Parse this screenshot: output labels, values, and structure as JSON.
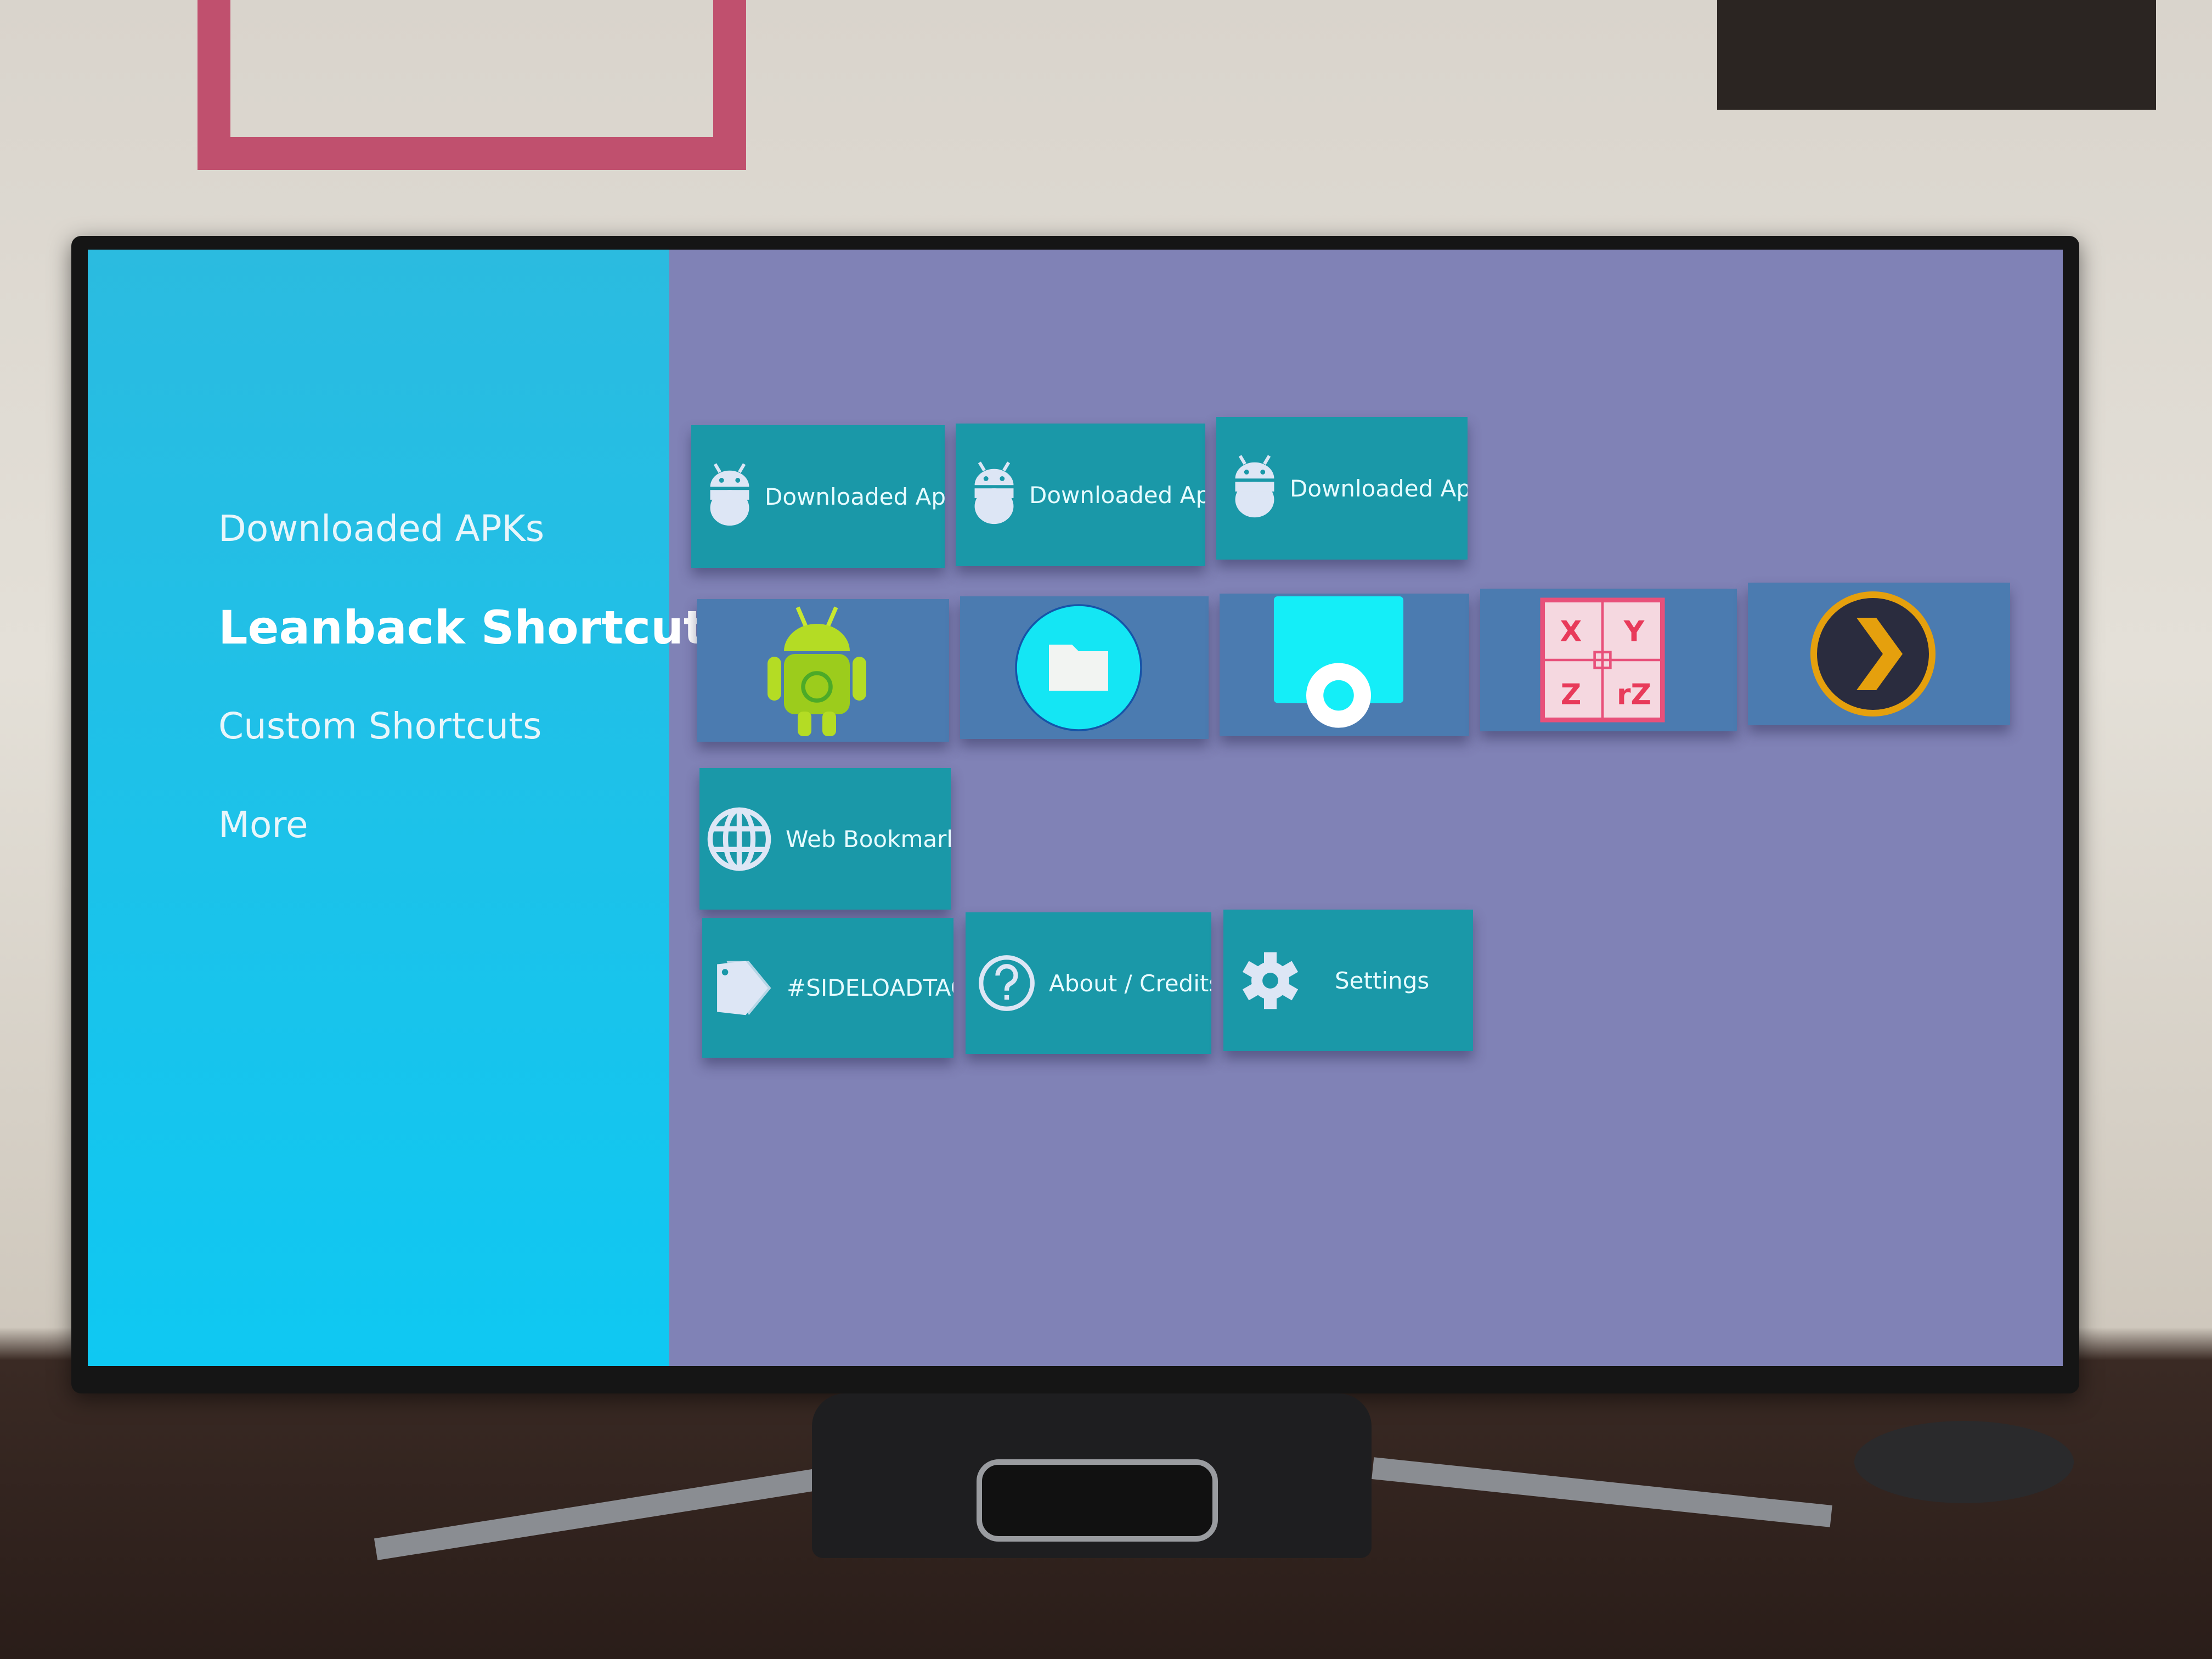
{
  "sidebar": {
    "items": [
      {
        "label": "Downloaded APKs",
        "selected": false
      },
      {
        "label": "Leanback Shortcuts",
        "selected": true
      },
      {
        "label": "Custom Shortcuts",
        "selected": false
      },
      {
        "label": "More",
        "selected": false
      }
    ]
  },
  "rows": {
    "downloaded": [
      {
        "label": "Downloaded Apk",
        "icon": "android-icon"
      },
      {
        "label": "Downloaded Apk",
        "icon": "android-icon"
      },
      {
        "label": "Downloaded Apk",
        "icon": "android-icon"
      }
    ],
    "apps": [
      {
        "icon": "nvidia-android-icon"
      },
      {
        "icon": "file-manager-icon"
      },
      {
        "icon": "record-app-icon"
      },
      {
        "icon": "xyz-app-icon",
        "letters": [
          "X",
          "Y",
          "Z",
          "rZ"
        ]
      },
      {
        "icon": "plex-icon"
      }
    ],
    "web": [
      {
        "label": "Web Bookmark",
        "icon": "globe-icon"
      }
    ],
    "misc": [
      {
        "label": "#SIDELOADTAGS",
        "icon": "tag-icon"
      },
      {
        "label": "About / Credits",
        "icon": "help-icon"
      },
      {
        "label": "Settings",
        "icon": "gear-icon"
      }
    ]
  },
  "colors": {
    "sidebar": "#14c4ee",
    "content_bg": "#8082b6",
    "tile": "#1a98a8",
    "app_tile": "#4b7bb0"
  }
}
